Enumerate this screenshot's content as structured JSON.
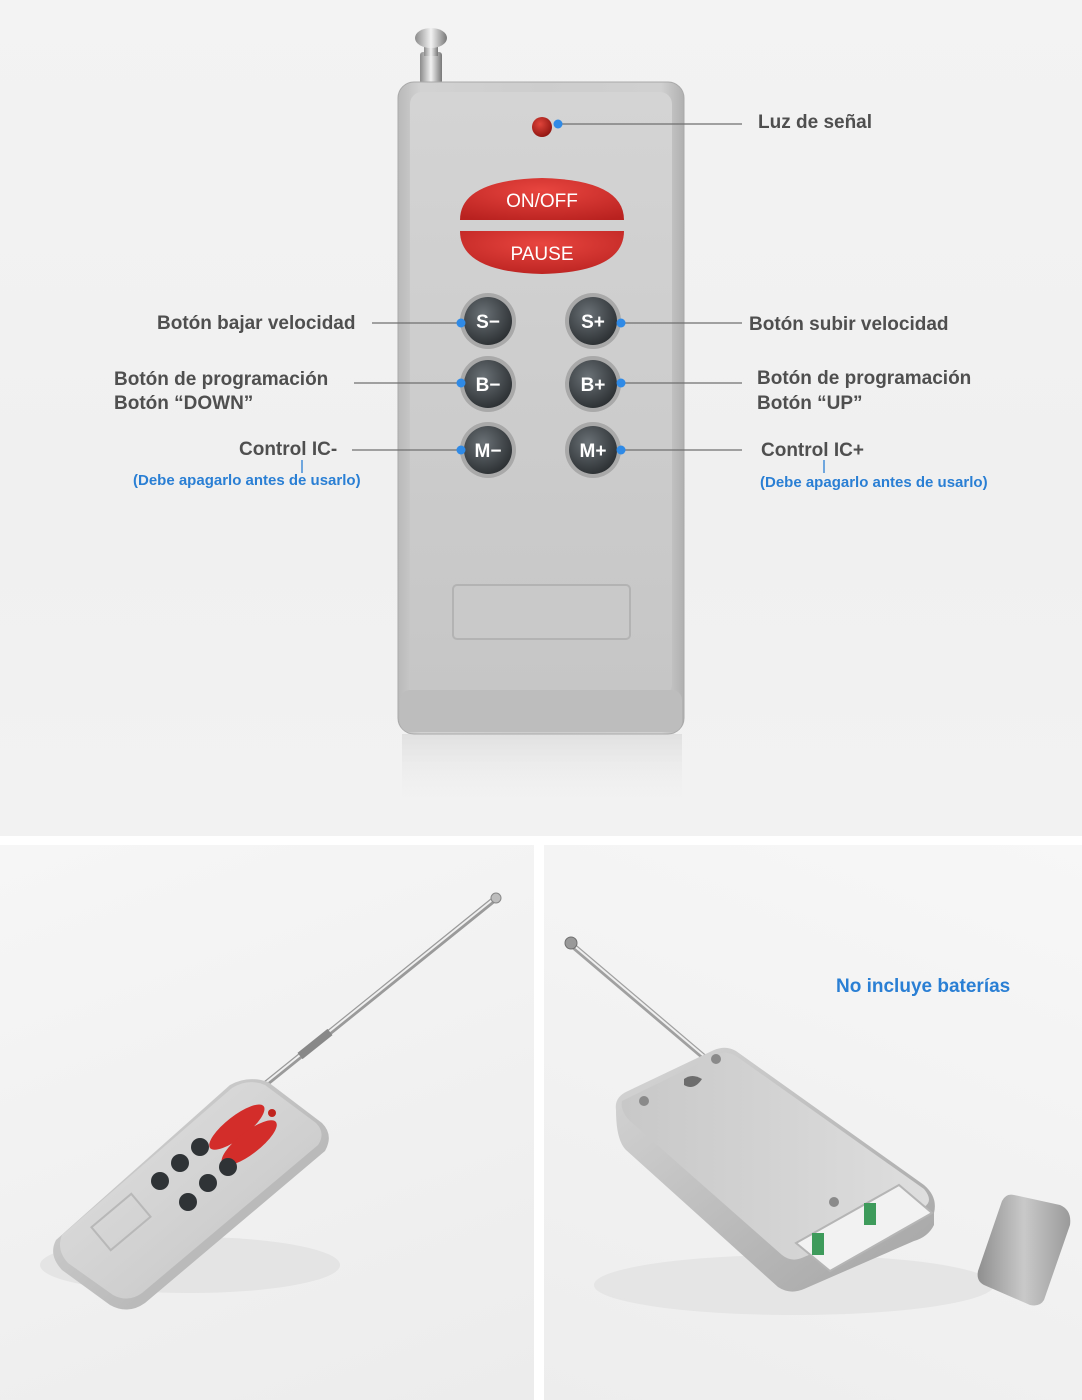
{
  "remote": {
    "onoff": "ON/OFF",
    "pause": "PAUSE",
    "keys": {
      "s_minus": "S−",
      "s_plus": "S+",
      "b_minus": "B−",
      "b_plus": "B+",
      "m_minus": "M−",
      "m_plus": "M+"
    }
  },
  "callouts": {
    "signal_light": "Luz de señal",
    "speed_down": "Botón bajar velocidad",
    "speed_up": "Botón subir velocidad",
    "prog_left_line1": "Botón de programación",
    "prog_left_line2": "Botón “DOWN”",
    "prog_right_line1": "Botón de programación",
    "prog_right_line2": "Botón “UP”",
    "ic_minus": "Control IC-",
    "ic_plus": "Control IC+",
    "ic_minus_note": "(Debe apagarlo antes de usarlo)",
    "ic_plus_note": "(Debe apagarlo antes de usarlo)"
  },
  "bottom_right": {
    "battery_note": "No incluye baterías"
  },
  "colors": {
    "callout_text": "#4f4f4f",
    "note_text": "#2a7fd4",
    "marker_dot": "#2f8ae6",
    "red_button": "#d9312f",
    "remote_body": "#c9c9c9"
  }
}
